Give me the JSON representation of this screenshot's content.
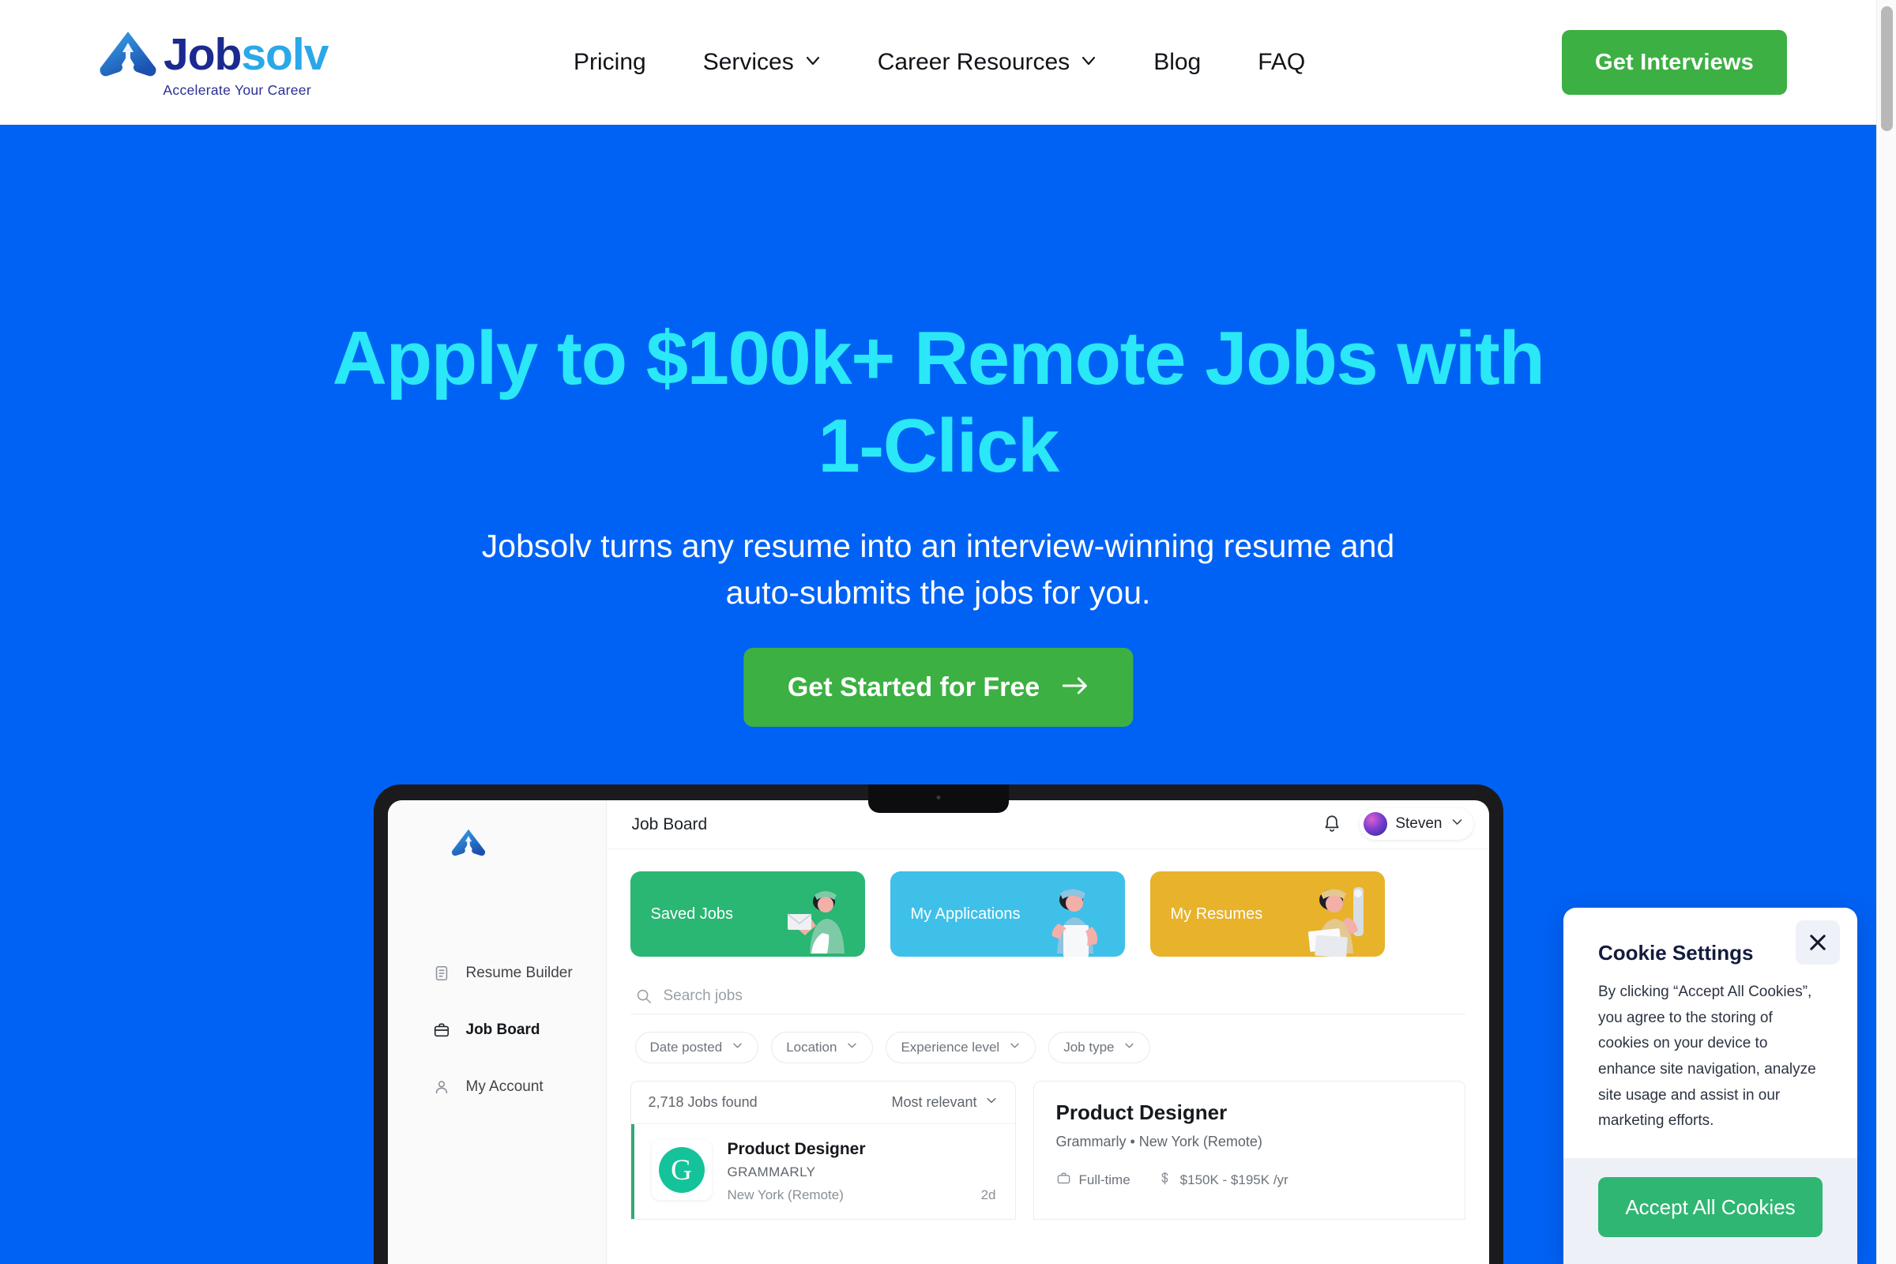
{
  "colors": {
    "hero_bg": "#0062f5",
    "hero_title": "#2ae8f7",
    "cta_green": "#3cb043",
    "cookie_green": "#2fb673",
    "logo_dark": "#1b2a8f",
    "logo_light": "#2aa8e8"
  },
  "header": {
    "logo": {
      "word_primary": "Job",
      "word_secondary": "solv",
      "tagline": "Accelerate Your Career",
      "mark_icon": "jobsolv-arrow-logo-icon"
    },
    "nav": [
      {
        "label": "Pricing",
        "has_dropdown": false
      },
      {
        "label": "Services",
        "has_dropdown": true
      },
      {
        "label": "Career Resources",
        "has_dropdown": true
      },
      {
        "label": "Blog",
        "has_dropdown": false
      },
      {
        "label": "FAQ",
        "has_dropdown": false
      }
    ],
    "cta_label": "Get Interviews"
  },
  "hero": {
    "title_line1": "Apply to $100k+ Remote Jobs with",
    "title_line2": "1-Click",
    "subtitle": "Jobsolv turns any resume into an interview-winning resume and auto-submits the jobs for you.",
    "cta_label": "Get Started for Free",
    "cta_icon": "arrow-right-icon"
  },
  "app_mockup": {
    "sidebar": {
      "logo_icon": "jobsolv-arrow-logo-icon",
      "items": [
        {
          "label": "Resume Builder",
          "icon": "document-icon",
          "active": false
        },
        {
          "label": "Job Board",
          "icon": "briefcase-icon",
          "active": true
        },
        {
          "label": "My Account",
          "icon": "user-icon",
          "active": false
        }
      ]
    },
    "topbar": {
      "title": "Job Board",
      "bell_icon": "notification-bell-icon",
      "user_name": "Steven",
      "user_chevron_icon": "chevron-down-icon"
    },
    "cards": [
      {
        "label": "Saved Jobs",
        "color": "#2ab673",
        "art": "person-with-envelope-illustration"
      },
      {
        "label": "My Applications",
        "color": "#3fc0e8",
        "art": "person-with-document-illustration"
      },
      {
        "label": "My Resumes",
        "color": "#e8b22a",
        "art": "person-with-pencil-illustration"
      }
    ],
    "search": {
      "placeholder": "Search jobs",
      "icon": "search-icon"
    },
    "filters": [
      {
        "label": "Date posted"
      },
      {
        "label": "Location"
      },
      {
        "label": "Experience level"
      },
      {
        "label": "Job type"
      }
    ],
    "results": {
      "count_label": "2,718 Jobs found",
      "sort_label": "Most relevant",
      "jobs": [
        {
          "title": "Product Designer",
          "company": "GRAMMARLY",
          "logo_letter": "G",
          "location": "New York (Remote)",
          "age": "2d"
        }
      ]
    },
    "detail": {
      "title": "Product Designer",
      "subtitle": "Grammarly  •  New York (Remote)",
      "employment_type": "Full-time",
      "employment_icon": "briefcase-icon",
      "salary": "$150K - $195K /yr",
      "salary_icon": "dollar-icon"
    }
  },
  "cookie_dialog": {
    "title": "Cookie Settings",
    "body": "By clicking “Accept All Cookies”, you agree to the storing of cookies on your device to enhance site navigation, analyze site usage and assist in our marketing efforts.",
    "accept_label": "Accept All Cookies",
    "close_icon": "close-icon"
  }
}
